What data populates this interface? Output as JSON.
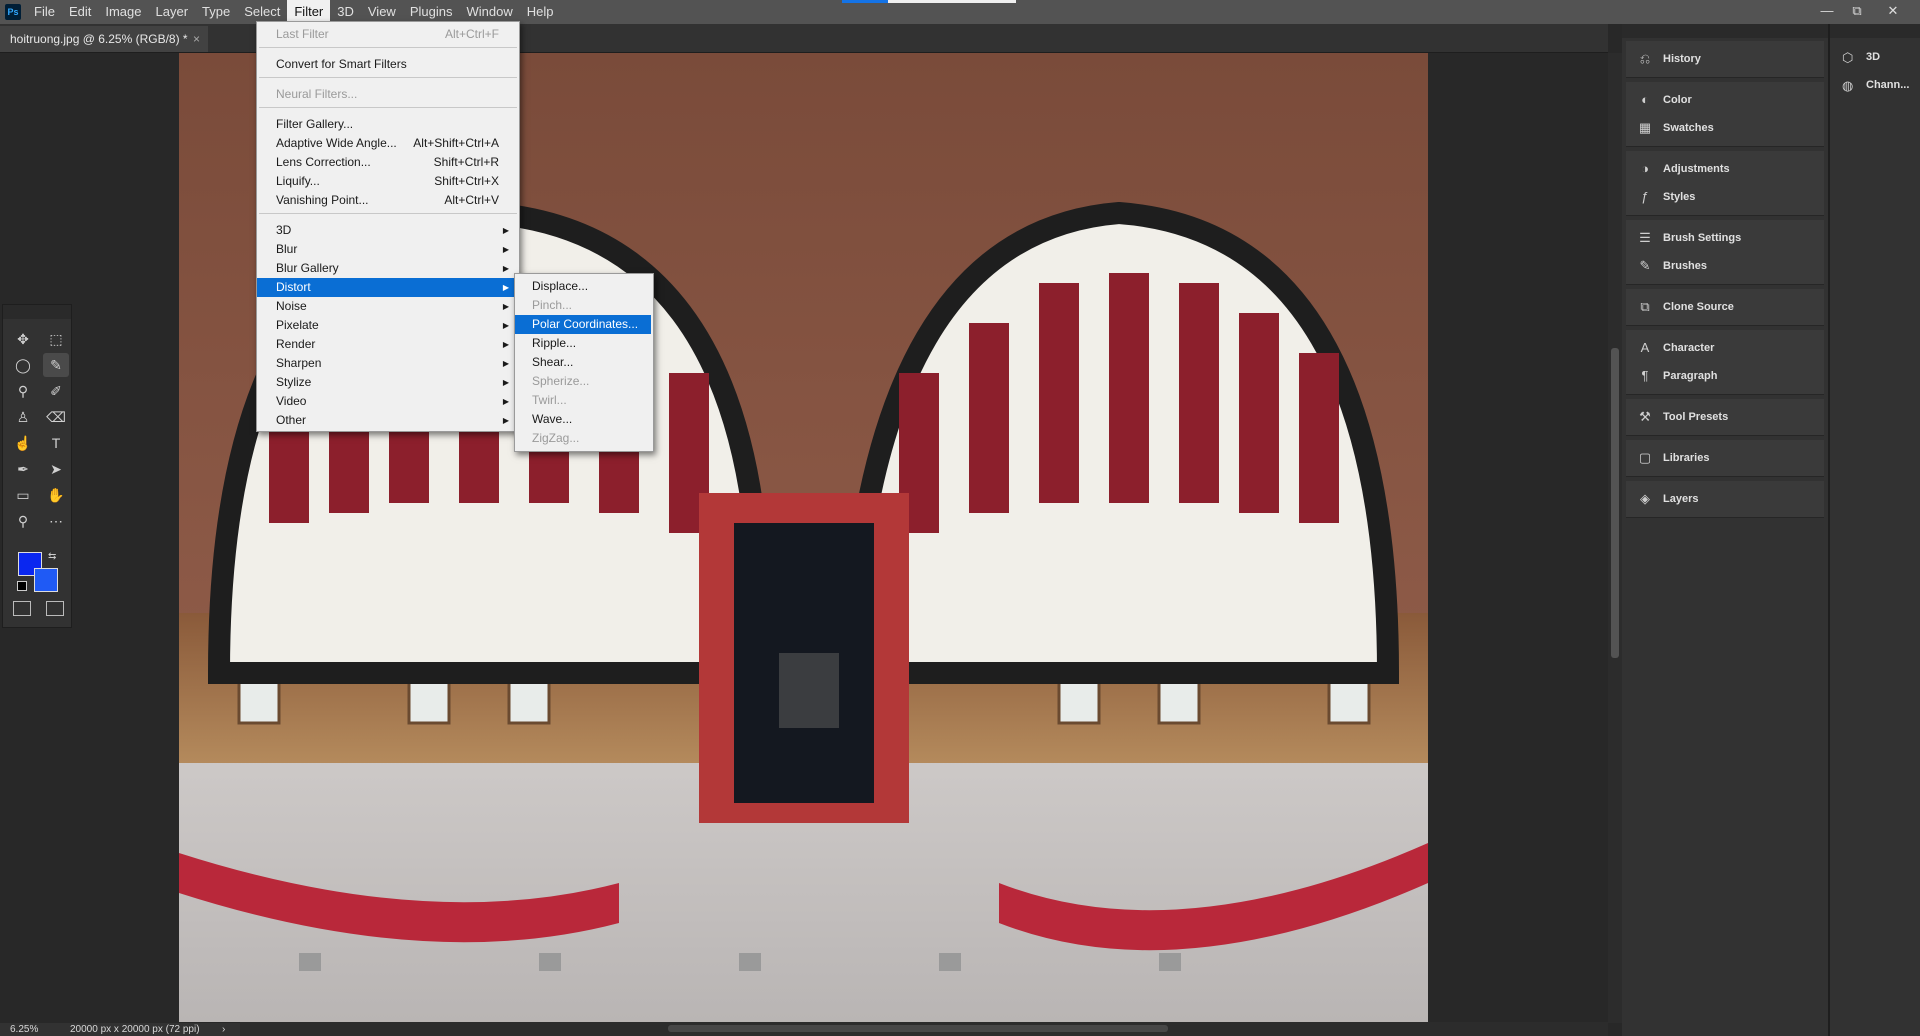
{
  "app": {
    "logo": "Ps"
  },
  "menubar": {
    "items": [
      "File",
      "Edit",
      "Image",
      "Layer",
      "Type",
      "Select",
      "Filter",
      "3D",
      "View",
      "Plugins",
      "Window",
      "Help"
    ],
    "active": "Filter",
    "window_controls": [
      "—",
      "⧉",
      "✕"
    ]
  },
  "document": {
    "tab_title": "hoitruong.jpg @ 6.25% (RGB/8) *",
    "tab_close": "×"
  },
  "status": {
    "zoom": "6.25%",
    "doc_size": "20000 px x 20000 px (72 ppi)",
    "arrow": "›"
  },
  "filter_menu": {
    "items": [
      {
        "label": "Last Filter",
        "shortcut": "Alt+Ctrl+F",
        "disabled": true
      },
      {
        "label": "Convert for Smart Filters",
        "shortcut": ""
      },
      {
        "label": "Neural Filters...",
        "shortcut": "",
        "disabled": true
      },
      {
        "label": "Filter Gallery...",
        "shortcut": ""
      },
      {
        "label": "Adaptive Wide Angle...",
        "shortcut": "Alt+Shift+Ctrl+A"
      },
      {
        "label": "Lens Correction...",
        "shortcut": "Shift+Ctrl+R"
      },
      {
        "label": "Liquify...",
        "shortcut": "Shift+Ctrl+X"
      },
      {
        "label": "Vanishing Point...",
        "shortcut": "Alt+Ctrl+V"
      },
      {
        "label": "3D",
        "submenu": true
      },
      {
        "label": "Blur",
        "submenu": true
      },
      {
        "label": "Blur Gallery",
        "submenu": true
      },
      {
        "label": "Distort",
        "submenu": true,
        "highlighted": true
      },
      {
        "label": "Noise",
        "submenu": true
      },
      {
        "label": "Pixelate",
        "submenu": true
      },
      {
        "label": "Render",
        "submenu": true
      },
      {
        "label": "Sharpen",
        "submenu": true
      },
      {
        "label": "Stylize",
        "submenu": true
      },
      {
        "label": "Video",
        "submenu": true
      },
      {
        "label": "Other",
        "submenu": true
      }
    ]
  },
  "distort_submenu": {
    "items": [
      {
        "label": "Displace..."
      },
      {
        "label": "Pinch...",
        "disabled": true
      },
      {
        "label": "Polar Coordinates...",
        "highlighted": true
      },
      {
        "label": "Ripple..."
      },
      {
        "label": "Shear..."
      },
      {
        "label": "Spherize...",
        "disabled": true
      },
      {
        "label": "Twirl...",
        "disabled": true
      },
      {
        "label": "Wave..."
      },
      {
        "label": "ZigZag...",
        "disabled": true
      }
    ]
  },
  "panels": {
    "groups": [
      [
        {
          "label": "History",
          "icon": "history-icon"
        }
      ],
      [
        {
          "label": "Color",
          "icon": "color-icon"
        },
        {
          "label": "Swatches",
          "icon": "swatches-icon"
        }
      ],
      [
        {
          "label": "Adjustments",
          "icon": "adjustments-icon"
        },
        {
          "label": "Styles",
          "icon": "styles-icon"
        }
      ],
      [
        {
          "label": "Brush Settings",
          "icon": "brush-settings-icon"
        },
        {
          "label": "Brushes",
          "icon": "brushes-icon"
        }
      ],
      [
        {
          "label": "Clone Source",
          "icon": "clone-source-icon"
        }
      ],
      [
        {
          "label": "Character",
          "icon": "character-icon"
        },
        {
          "label": "Paragraph",
          "icon": "paragraph-icon"
        }
      ],
      [
        {
          "label": "Tool Presets",
          "icon": "tool-presets-icon"
        }
      ],
      [
        {
          "label": "Libraries",
          "icon": "libraries-icon"
        }
      ],
      [
        {
          "label": "Layers",
          "icon": "layers-icon"
        }
      ]
    ],
    "col2": [
      {
        "label": "3D",
        "icon": "3d-cube-icon"
      },
      {
        "label": "Chann...",
        "icon": "channels-icon"
      }
    ]
  },
  "tools": [
    "move-tool-icon",
    "marquee-tool-icon",
    "lasso-tool-icon",
    "quick-selection-tool-icon",
    "eyedropper-tool-icon",
    "brush-tool-icon",
    "clone-stamp-tool-icon",
    "eraser-tool-icon",
    "smudge-tool-icon",
    "type-tool-icon",
    "pen-tool-icon",
    "path-selection-tool-icon",
    "rectangle-tool-icon",
    "hand-tool-icon",
    "zoom-tool-icon",
    "more-tools-icon"
  ],
  "colors": {
    "foreground": "#0a27f0",
    "background": "#1f5af5",
    "menu_highlight": "#0a6ed4"
  }
}
